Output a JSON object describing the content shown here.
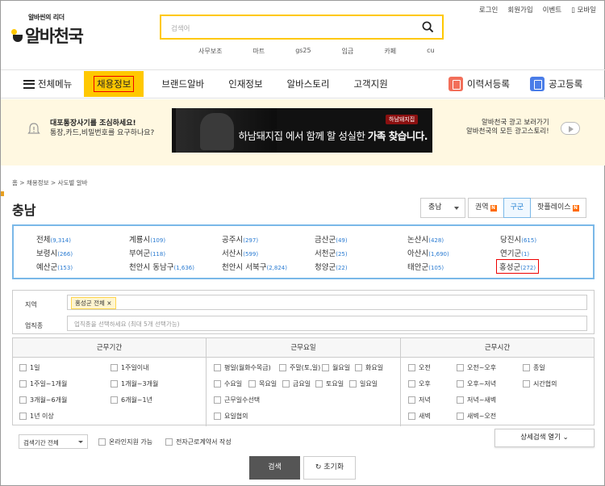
{
  "util_links": [
    "로그인",
    "회원가입",
    "이벤트",
    "모바일"
  ],
  "logo": {
    "tagline": "알바씬의 리더",
    "name": "알바천국"
  },
  "search": {
    "placeholder": "검색어",
    "keywords": [
      "사무보조",
      "마트",
      "gs25",
      "임금",
      "카페",
      "cu"
    ]
  },
  "gnb": {
    "menu": "전체메뉴",
    "items": [
      "채용정보",
      "브랜드알바",
      "인재정보",
      "알바스토리",
      "고객지원"
    ],
    "resume": "이력서등록",
    "post": "공고등록",
    "resume_color": "#f26f5a",
    "post_color": "#4a7de8"
  },
  "notice": {
    "line1": "대포통장사기를 조심하세요!",
    "line2": "통장,카드,비밀번호를 요구하나요?"
  },
  "ad": {
    "brand": "하남돼지집",
    "text_a": "하남돼지집",
    "text_b": " 에서 함께 할 성실한 ",
    "text_c": "가족 찾습니다."
  },
  "ad_link": {
    "line1": "알바천국 광고 보러가기",
    "line2": "알바천국의 모든 광고스토리!"
  },
  "breadcrumb": "홈 > 채용정보 > 사도별 알바",
  "page_title": "충남",
  "region_select": "충남",
  "tabs": [
    {
      "label": "권역",
      "badge": "N"
    },
    {
      "label": "구군",
      "badge": ""
    },
    {
      "label": "핫플레이스",
      "badge": "N"
    }
  ],
  "regions": [
    {
      "name": "전체",
      "count": "(9,314)"
    },
    {
      "name": "계룡시",
      "count": "(109)"
    },
    {
      "name": "공주시",
      "count": "(297)"
    },
    {
      "name": "금산군",
      "count": "(49)"
    },
    {
      "name": "논산시",
      "count": "(428)"
    },
    {
      "name": "당진시",
      "count": "(615)"
    },
    {
      "name": "보령시",
      "count": "(266)"
    },
    {
      "name": "부여군",
      "count": "(118)"
    },
    {
      "name": "서산시",
      "count": "(599)"
    },
    {
      "name": "서천군",
      "count": "(25)"
    },
    {
      "name": "아산시",
      "count": "(1,690)"
    },
    {
      "name": "연기군",
      "count": "(1)"
    },
    {
      "name": "예산군",
      "count": "(153)"
    },
    {
      "name": "천안시 동남구",
      "count": "(1,636)"
    },
    {
      "name": "천안시 서북구",
      "count": "(2,824)"
    },
    {
      "name": "청양군",
      "count": "(22)"
    },
    {
      "name": "태안군",
      "count": "(105)"
    },
    {
      "name": "홍성군",
      "count": "(272)"
    }
  ],
  "filter": {
    "region_label": "지역",
    "region_tag": "홍성군 전체 ×",
    "job_label": "업직종",
    "job_placeholder": "업직종을 선택하세요 (최대 5개 선택가능)"
  },
  "period": {
    "title": "근무기간",
    "options": [
      "1일",
      "1주일이내",
      "1주일~1개월",
      "1개월~3개월",
      "3개월~6개월",
      "6개월~1년",
      "1년 이상"
    ]
  },
  "days": {
    "title": "근무요일",
    "options": [
      "평일(월화수목금)",
      "주말(토,일)",
      "월요일",
      "화요일",
      "수요일",
      "목요일",
      "금요일",
      "토요일",
      "일요일",
      "근무일수선택",
      "요일협의"
    ]
  },
  "time": {
    "title": "근무시간",
    "options": [
      "오전",
      "오전~오후",
      "종일",
      "오후",
      "오후~저녁",
      "시간협의",
      "저녁",
      "저녁~새벽",
      "새벽",
      "새벽~오전"
    ]
  },
  "bottom": {
    "period_select": "검색기간 전체",
    "online": "온라인지원 가능",
    "econtract": "전자근로계약서 작성",
    "detail": "상세검색 열기",
    "search": "검색",
    "reset": "초기화"
  }
}
